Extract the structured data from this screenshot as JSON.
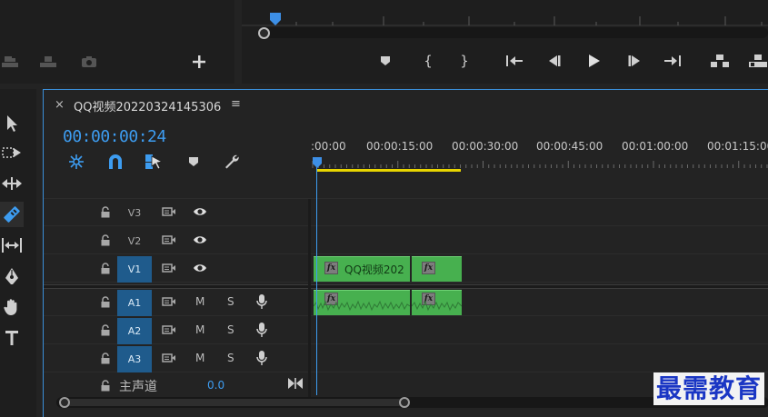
{
  "sequence": {
    "tab_title": "QQ视频20220324145306",
    "timecode": "00:00:00:24"
  },
  "ruler": {
    "labels": [
      ":00:00",
      "00:00:15:00",
      "00:00:30:00",
      "00:00:45:00",
      "00:01:00:00",
      "00:01:15:00"
    ]
  },
  "tracks": {
    "video": [
      {
        "label": "V3",
        "targeted": false
      },
      {
        "label": "V2",
        "targeted": false
      },
      {
        "label": "V1",
        "targeted": true
      }
    ],
    "audio": [
      {
        "label": "A1",
        "targeted": true,
        "mute": "M",
        "solo": "S"
      },
      {
        "label": "A2",
        "targeted": true,
        "mute": "M",
        "solo": "S"
      },
      {
        "label": "A3",
        "targeted": true,
        "mute": "M",
        "solo": "S"
      }
    ],
    "master": {
      "label": "主声道",
      "value": "0.0"
    }
  },
  "clip": {
    "name": "QQ视频202",
    "fx_label": "fx"
  },
  "watermark": "最需教育",
  "colors": {
    "accent_blue": "#3a8fd9",
    "clip_green": "#47b04f",
    "timecode_blue": "#3d9cf0",
    "work_area_yellow": "#e8d400"
  }
}
